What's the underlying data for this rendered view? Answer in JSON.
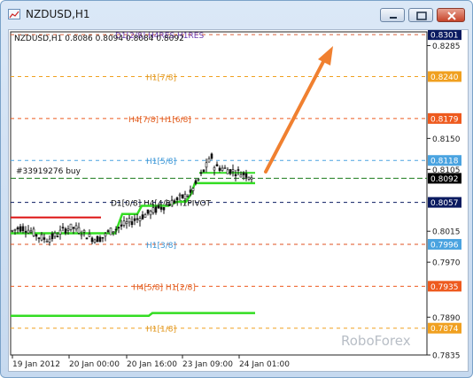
{
  "window": {
    "title": "NZDUSD,H1"
  },
  "chart_data": {
    "type": "candlestick",
    "symbol_info": "NZDUSD,H1  0.8086 0.8094 0.8084 0.8092",
    "watermark": "RoboForex",
    "order_label": "#33919276 buy",
    "current_price": "0.8092",
    "ylim": [
      0.7835,
      0.8305
    ],
    "x_ticks": [
      "19 Jan 2012",
      "20 Jan 00:00",
      "20 Jan 16:00",
      "23 Jan 09:00",
      "24 Jan 01:00"
    ],
    "y_ticks": [
      "0.8285",
      "0.8150",
      "0.8105",
      "0.8015",
      "0.7970",
      "0.7890",
      "0.7835"
    ],
    "levels": [
      {
        "label": "D1[2/8] H4RES H1RES",
        "price": "0.8301",
        "color": "#d9603a",
        "label_color": "#6a3ab0",
        "badge": "#0a1a60"
      },
      {
        "label": "H1[7/8]",
        "price": "0.8240",
        "color": "#f0a020",
        "label_color": "#e0951a",
        "badge": "#f0a020"
      },
      {
        "label": "H4[7/8] H1[6/8]",
        "price": "0.8179",
        "color": "#ee5a1e",
        "label_color": "#e05a1a",
        "badge": "#ee5a1e"
      },
      {
        "label": "H1[5/8]",
        "price": "0.8118",
        "color": "#4aa3e0",
        "label_color": "#3a95d6",
        "badge": "#4aa3e0"
      },
      {
        "label": "D1[0/8] H4[4/8] H1PIVOT",
        "price": "0.8057",
        "color": "#0a1a60",
        "label_color": "#101010",
        "badge": "#0a1a60"
      },
      {
        "label": "H1[3/8]",
        "price": "0.7996",
        "color": "#e05020",
        "label_color": "#3a95d6",
        "badge": "#4aa3e0"
      },
      {
        "label": "H4[5/8] H1[2/8]",
        "price": "0.7935",
        "color": "#ee5a1e",
        "label_color": "#e05a1a",
        "badge": "#ee5a1e"
      },
      {
        "label": "H1[1/8]",
        "price": "0.7874",
        "color": "#f0a020",
        "label_color": "#e0951a",
        "badge": "#f0a020"
      }
    ],
    "colors": {
      "green_line": "#33dd22",
      "red_line": "#dd1111",
      "arrow": "#f08030",
      "order_line": "#1a7a1a"
    }
  }
}
